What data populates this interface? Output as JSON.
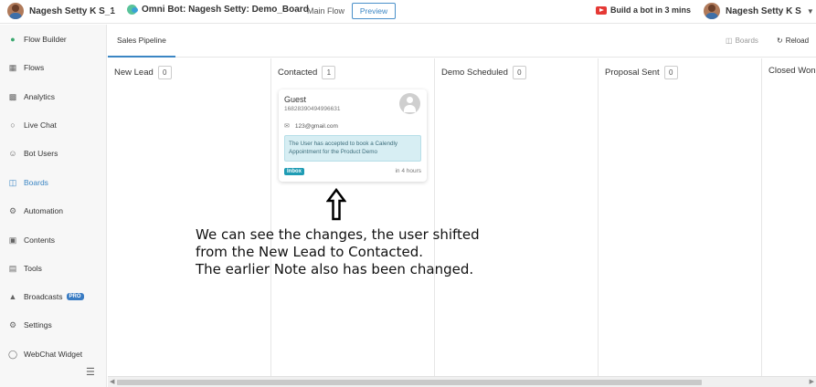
{
  "topbar": {
    "user_name": "Nagesh Setty K S_1",
    "bot_name": "Omni Bot: Nagesh Setty: Demo_Board",
    "flow_name": "Main Flow",
    "preview_label": "Preview",
    "youtube_label": "Build a bot in 3 mins",
    "account_name": "Nagesh Setty K S",
    "colors": {
      "accent": "#3b86c4",
      "youtube": "#e53935"
    }
  },
  "sidebar": {
    "items": [
      {
        "label": "Flow Builder",
        "icon": "chat-bubbles-icon"
      },
      {
        "label": "Flows",
        "icon": "grid-icon"
      },
      {
        "label": "Analytics",
        "icon": "chart-icon"
      },
      {
        "label": "Live Chat",
        "icon": "headset-icon"
      },
      {
        "label": "Bot Users",
        "icon": "user-icon"
      },
      {
        "label": "Boards",
        "icon": "board-icon",
        "active": true
      },
      {
        "label": "Automation",
        "icon": "gear-cycle-icon"
      },
      {
        "label": "Contents",
        "icon": "contents-icon"
      },
      {
        "label": "Tools",
        "icon": "toolbox-icon"
      },
      {
        "label": "Broadcasts",
        "icon": "megaphone-icon",
        "badge": "PRO"
      },
      {
        "label": "Settings",
        "icon": "gear-icon"
      },
      {
        "label": "WebChat Widget",
        "icon": "widget-icon"
      }
    ]
  },
  "main": {
    "tab": "Sales Pipeline",
    "boards_label": "Boards",
    "reload_label": "Reload",
    "columns": [
      {
        "title": "New Lead",
        "count": "0"
      },
      {
        "title": "Contacted",
        "count": "1"
      },
      {
        "title": "Demo Scheduled",
        "count": "0"
      },
      {
        "title": "Proposal Sent",
        "count": "0"
      },
      {
        "title": "Closed Won",
        "count": ""
      }
    ],
    "card": {
      "name": "Guest",
      "phone": "16828390494996631",
      "email": "123@gmail.com",
      "note": "The User has accepted to book a Calendly Appointment for the Product Demo",
      "tag": "Inbox",
      "time": "in 4 hours"
    }
  },
  "annotation": {
    "lines": [
      "We can see the changes, the user shifted",
      "from the New Lead to Contacted.",
      "The earlier Note also has been changed."
    ]
  }
}
